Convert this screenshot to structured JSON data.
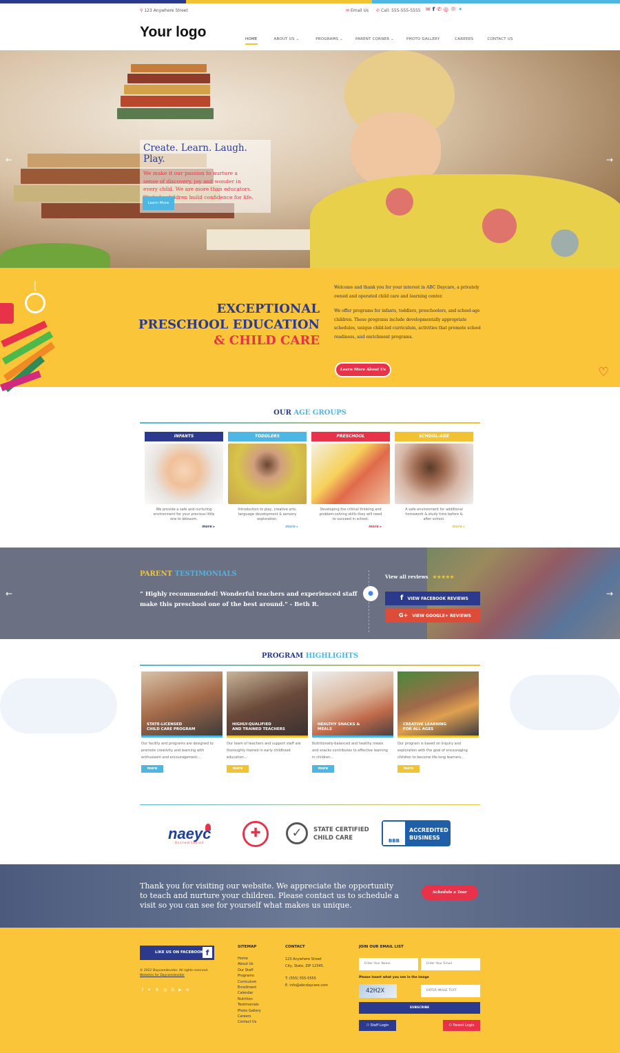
{
  "topbar": {
    "address": "123 Anywhere Street",
    "email": "Email Us",
    "call": "Call: 555-555-5555"
  },
  "logo": "Your logo",
  "nav": {
    "items": [
      {
        "label": "HOME"
      },
      {
        "label": "ABOUT US ⌄"
      },
      {
        "label": "PROGRAMS ⌄"
      },
      {
        "label": "PARENT CORNER ⌄"
      },
      {
        "label": "PHOTO GALLERY"
      },
      {
        "label": "CAREERS"
      },
      {
        "label": "CONTACT US"
      }
    ]
  },
  "hero": {
    "title": "Create. Learn. Laugh. Play.",
    "body_lines": [
      "We make it our passion to nurture a",
      "sense of discovery, joy and wonder in",
      "every child. We are more than educators.",
      "We help children build confidence for life."
    ],
    "button": "Learn More"
  },
  "intro": {
    "heading_line1": "EXCEPTIONAL",
    "heading_line2": "PRESCHOOL EDUCATION",
    "heading_line3": "& CHILD CARE",
    "para1": "Welcome and thank you for your interest in ABC Daycare, a privately owned and operated child care and learning center.",
    "para2": "We offer programs for infants, toddlers, preschoolers, and school-age children. These programs include developmentally appropriate schedules, unique child-led curriculum, activities that promote school readiness, and enrichment programs.",
    "button": "Learn More About Us"
  },
  "age_groups": {
    "title_a": "OUR",
    "title_b": "AGE GROUPS",
    "items": [
      {
        "label": "INFANTS",
        "text": "We provide a safe and nurturing environment for your precious little one to blossom.",
        "more": "more",
        "color": "#2b3a8c"
      },
      {
        "label": "TODDLERS",
        "text": "Introduction to play, creative arts, language development & sensory exploration.",
        "more": "more",
        "color": "#4db6e3"
      },
      {
        "label": "PRESCHOOL",
        "text": "Developing the critical thinking and problem-solving skills they will need to succeed in school.",
        "more": "more",
        "color": "#e8324a"
      },
      {
        "label": "SCHOOL-AGE",
        "text": "A safe environment for additional homework & study time before & after school.",
        "more": "more",
        "color": "#f1c232"
      }
    ]
  },
  "testimonials": {
    "title_a": "PARENT",
    "title_b": "TESTIMONIALS",
    "quote_line1": "Highly recommended! Wonderful teachers and experienced staff",
    "quote_line2": "make this preschool one of the best around.\" - Beth R.",
    "view_all": "View all reviews",
    "stars": "★★★★★",
    "facebook": "VIEW FACEBOOK REVIEWS",
    "google": "VIEW GOOGLE+ REVIEWS"
  },
  "highlights": {
    "title_a": "PROGRAM",
    "title_b": "HIGHLIGHTS",
    "items": [
      {
        "cap1": "STATE-LICENSED",
        "cap2": "CHILD CARE PROGRAM",
        "text": [
          "Our facility and programs are designed to",
          "promote creativity and learning with",
          "enthusiasm and encouragement..."
        ],
        "more": "more",
        "color": "#4db6e3"
      },
      {
        "cap1": "HIGHLY-QUALIFIED",
        "cap2": "AND TRAINED TEACHERS",
        "text": [
          "Our team of teachers and support staff are",
          "thoroughly trained in early childhood",
          "education..."
        ],
        "more": "more",
        "color": "#f1c232"
      },
      {
        "cap1": "HEALTHY SNACKS &",
        "cap2": "MEALS",
        "text": [
          "Nutritionally-balanced and healthy meals",
          "and snacks contributes to effective learning",
          "in children..."
        ],
        "more": "more",
        "color": "#4db6e3"
      },
      {
        "cap1": "CREATIVE LEARNING",
        "cap2": "FOR ALL AGES",
        "text": [
          "Our program is based on inquiry and",
          "exploration with the goal of encouraging",
          "children to become life-long learners..."
        ],
        "more": "more",
        "color": "#f1c232"
      }
    ]
  },
  "badges": {
    "naeyc": "naeyc",
    "naeyc_sub": "Accreditation",
    "state1": "STATE CERTIFIED",
    "state2": "CHILD CARE",
    "bbb1": "ACCREDITED",
    "bbb2": "BUSINESS",
    "bbb": "BBB"
  },
  "cta": {
    "line1": "Thank you for visiting our website. We appreciate the opportunity",
    "line2": "to teach and nurture your children. Please contact us to schedule a",
    "line3": "visit so you can see for yourself what makes us unique.",
    "button": "Schedule a Tour"
  },
  "footer": {
    "like": "LIKE US ON FACEBOOK",
    "copyright": "© 2022 Daycaredevider. All rights reserved.",
    "webby": "Websites for Daycaredevider",
    "sitemap_title": "SITEMAP",
    "sitemap": [
      "Home",
      "About Us",
      "Our Staff",
      "Programs",
      "Curriculum",
      "Enrollment",
      "Calendar",
      "Nutrition",
      "Testimonials",
      "Photo Gallery",
      "Careers",
      "Contact Us"
    ],
    "contact_title": "CONTACT",
    "contact_addr1": "123 Anywhere Street",
    "contact_addr2": "City, State, ZIP 12345.",
    "contact_phone": "T: (555) 555-5555",
    "contact_email": "E: info@abcdaycare.com",
    "email_title": "JOIN OUR EMAIL LIST",
    "name_ph": "Enter Your Name",
    "email_ph": "Enter Your Email",
    "captcha_prompt": "Please insert what you see in the image",
    "captcha": "42H2X",
    "captcha_ph": "ENTER IMAGE TEXT",
    "subscribe": "SUBSCRIBE",
    "staff": "Staff Login",
    "parent": "Parent Login"
  }
}
